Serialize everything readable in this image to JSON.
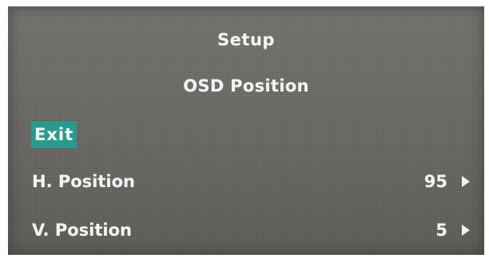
{
  "osd": {
    "title": "Setup",
    "subtitle": "OSD Position",
    "exit_label": "Exit",
    "items": [
      {
        "label": "H. Position",
        "value": "95",
        "icon": "arrow-right-icon"
      },
      {
        "label": "V. Position",
        "value": "5",
        "icon": "arrow-right-icon"
      }
    ],
    "colors": {
      "background": "#6f6d69",
      "highlight": "#2b9a8c",
      "text": "#f3f3f3"
    }
  }
}
